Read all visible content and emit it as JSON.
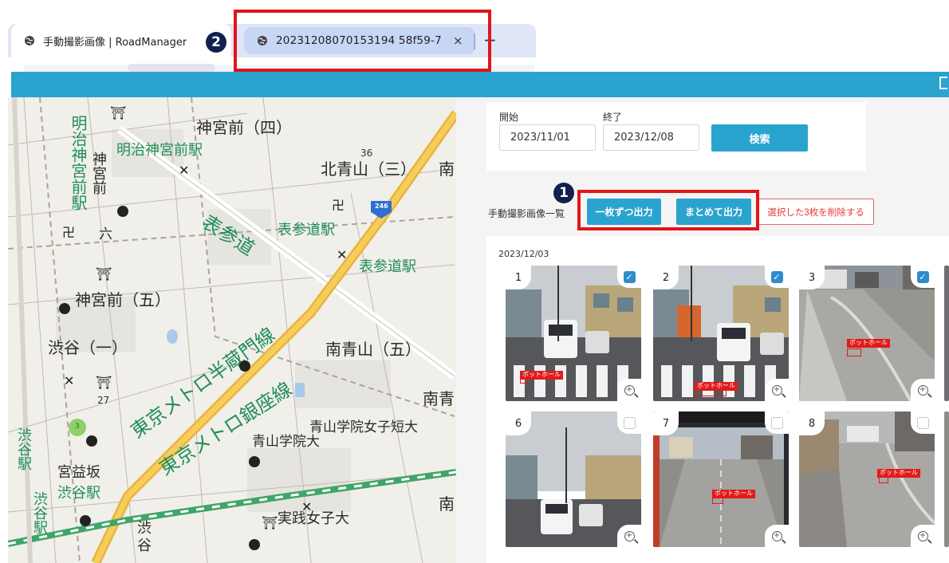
{
  "browser": {
    "tabs": [
      {
        "title": "手動撮影画像 | RoadManager",
        "icon": "globe-icon"
      },
      {
        "title": "20231208070153194 58f59-7",
        "icon": "globe-icon"
      }
    ],
    "close_symbol": "×",
    "new_tab_symbol": "+"
  },
  "markers": {
    "one": "1",
    "two": "2"
  },
  "map": {
    "labels_black": [
      "神宮前（四）",
      "北青山（三）",
      "南",
      "神宮前（五）",
      "渋谷（一）",
      "南青山（五）",
      "南青",
      "青山学院女子短大",
      "青山学院大",
      "宮益坂",
      "実践女子大",
      "渋",
      "谷",
      "南",
      "六",
      "神宮前",
      "36",
      "27"
    ],
    "labels_green": [
      "明治神宮前駅",
      "明治神宮前駅",
      "表参道",
      "表参道駅",
      "表参道駅",
      "東京メトロ半蔵門線",
      "東京メトロ銀座線",
      "渋谷駅",
      "渋谷駅",
      "渋谷駅"
    ],
    "route_badge": "246",
    "cluster_count": "3"
  },
  "search": {
    "start_label": "開始",
    "end_label": "終了",
    "start_value": "2023/11/01",
    "end_value": "2023/12/08",
    "button": "検索"
  },
  "list": {
    "label": "手動撮影画像一覧",
    "export_single": "一枚ずつ出力",
    "export_bulk": "まとめて出力",
    "delete_selected": "選択した3枚を削除する"
  },
  "gallery": {
    "date": "2023/12/03",
    "detection_label": "ポットホール",
    "items": [
      {
        "num": "1",
        "checked": true,
        "scene": "street"
      },
      {
        "num": "2",
        "checked": true,
        "scene": "street"
      },
      {
        "num": "3",
        "checked": true,
        "scene": "road"
      },
      {
        "num": "6",
        "checked": false,
        "scene": "street"
      },
      {
        "num": "7",
        "checked": false,
        "scene": "road"
      },
      {
        "num": "8",
        "checked": false,
        "scene": "road"
      }
    ]
  },
  "colors": {
    "accent": "#2aa4cf",
    "danger": "#e23a3a",
    "highlight": "#e2141a",
    "marker": "#10214e"
  }
}
